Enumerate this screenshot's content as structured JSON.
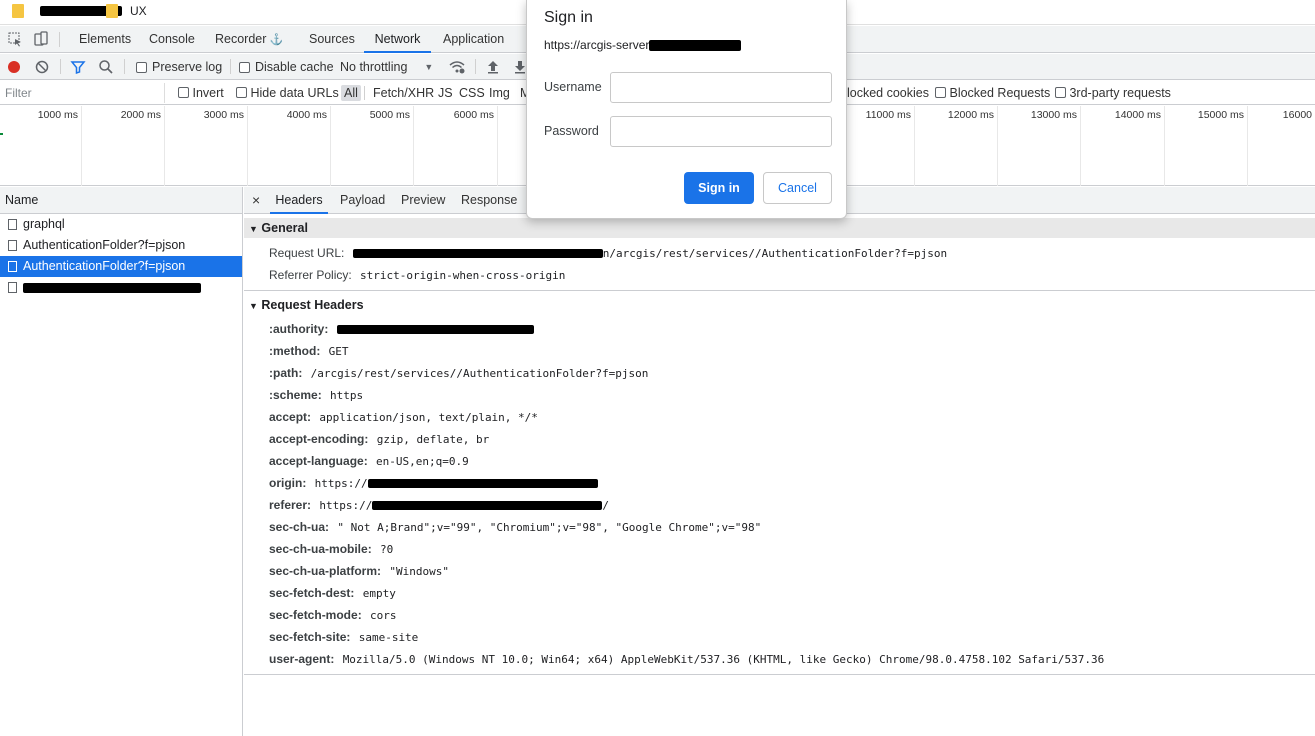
{
  "bookmarks": {
    "items": [
      {
        "label": "",
        "icon": "folder-icon",
        "redacted": true
      },
      {
        "label": "UX",
        "icon": "folder-icon"
      }
    ]
  },
  "devtools": {
    "icons": [
      "inspect-element-icon",
      "device-toolbar-icon"
    ],
    "tabs": [
      "Elements",
      "Console",
      "Recorder",
      "Sources",
      "Network",
      "Application"
    ],
    "active_tab": "Network",
    "recorder_icon": "flask-icon"
  },
  "toolbar": {
    "preserve_log": "Preserve log",
    "disable_cache": "Disable cache",
    "throttling": "No throttling",
    "icons": [
      "record-icon",
      "clear-icon",
      "filter-icon",
      "search-icon",
      "wifi-icon",
      "upload-icon",
      "download-icon"
    ]
  },
  "filter": {
    "placeholder": "Filter",
    "invert": "Invert",
    "hide_data_urls": "Hide data URLs",
    "types": [
      "All",
      "Fetch/XHR",
      "JS",
      "CSS",
      "Img",
      "M"
    ],
    "blocked_cookies": "locked cookies",
    "blocked_requests": "Blocked Requests",
    "third_party": "3rd-party requests"
  },
  "timeline": {
    "ticks": [
      "1000 ms",
      "2000 ms",
      "3000 ms",
      "4000 ms",
      "5000 ms",
      "6000 ms",
      "11000 ms",
      "12000 ms",
      "13000 ms",
      "14000 ms",
      "15000 ms",
      "16000"
    ]
  },
  "name_panel": {
    "header": "Name",
    "rows": [
      {
        "name": "graphql"
      },
      {
        "name": "AuthenticationFolder?f=pjson"
      },
      {
        "name": "AuthenticationFolder?f=pjson",
        "selected": true
      },
      {
        "name": "",
        "redacted": true
      }
    ]
  },
  "detail_panel": {
    "close": "×",
    "tabs": [
      "Headers",
      "Payload",
      "Preview",
      "Response"
    ],
    "active_tab": "Headers",
    "general": {
      "title": "General",
      "request_url_key": "Request URL:",
      "request_url_value": "n/arcgis/rest/services//AuthenticationFolder?f=pjson",
      "referrer_policy_key": "Referrer Policy:",
      "referrer_policy_value": "strict-origin-when-cross-origin"
    },
    "request_headers": {
      "title": "Request Headers",
      "rows": [
        {
          "key": ":authority:",
          "value": ""
        },
        {
          "key": ":method:",
          "value": "GET"
        },
        {
          "key": ":path:",
          "value": "/arcgis/rest/services//AuthenticationFolder?f=pjson"
        },
        {
          "key": ":scheme:",
          "value": "https"
        },
        {
          "key": "accept:",
          "value": "application/json, text/plain, */*"
        },
        {
          "key": "accept-encoding:",
          "value": "gzip, deflate, br"
        },
        {
          "key": "accept-language:",
          "value": "en-US,en;q=0.9"
        },
        {
          "key": "origin:",
          "value": "https://"
        },
        {
          "key": "referer:",
          "value": "https://"
        },
        {
          "key": "sec-ch-ua:",
          "value": "\" Not A;Brand\";v=\"99\", \"Chromium\";v=\"98\", \"Google Chrome\";v=\"98\""
        },
        {
          "key": "sec-ch-ua-mobile:",
          "value": "?0"
        },
        {
          "key": "sec-ch-ua-platform:",
          "value": "\"Windows\""
        },
        {
          "key": "sec-fetch-dest:",
          "value": "empty"
        },
        {
          "key": "sec-fetch-mode:",
          "value": "cors"
        },
        {
          "key": "sec-fetch-site:",
          "value": "same-site"
        },
        {
          "key": "user-agent:",
          "value": "Mozilla/5.0 (Windows NT 10.0; Win64; x64) AppleWebKit/537.36 (KHTML, like Gecko) Chrome/98.0.4758.102 Safari/537.36"
        }
      ]
    }
  },
  "signin_dialog": {
    "title": "Sign in",
    "url": "https://arcgis-server",
    "username_label": "Username",
    "password_label": "Password",
    "sign_in_button": "Sign in",
    "cancel_button": "Cancel"
  },
  "colors": {
    "accent": "#1a73e8",
    "record": "#d93025",
    "folder": "#f5c542"
  }
}
